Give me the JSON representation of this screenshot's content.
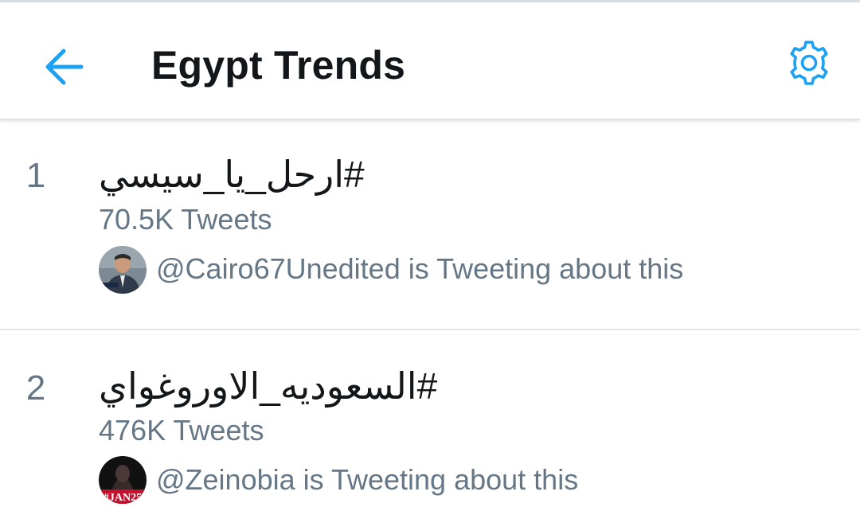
{
  "header": {
    "title": "Egypt Trends",
    "back_icon": "arrow-left-icon",
    "settings_icon": "gear-icon",
    "accent_color": "#1da1f2"
  },
  "trends": [
    {
      "rank": "1",
      "name": "#ارحل_يا_سيسي",
      "tweet_count": "70.5K Tweets",
      "context": "@Cairo67Unedited is Tweeting about this"
    },
    {
      "rank": "2",
      "name": "#السعوديه_الاوروغواي",
      "tweet_count": "476K Tweets",
      "context": "@Zeinobia is Tweeting about this",
      "avatar_overlay_text": "#JAN25"
    }
  ]
}
